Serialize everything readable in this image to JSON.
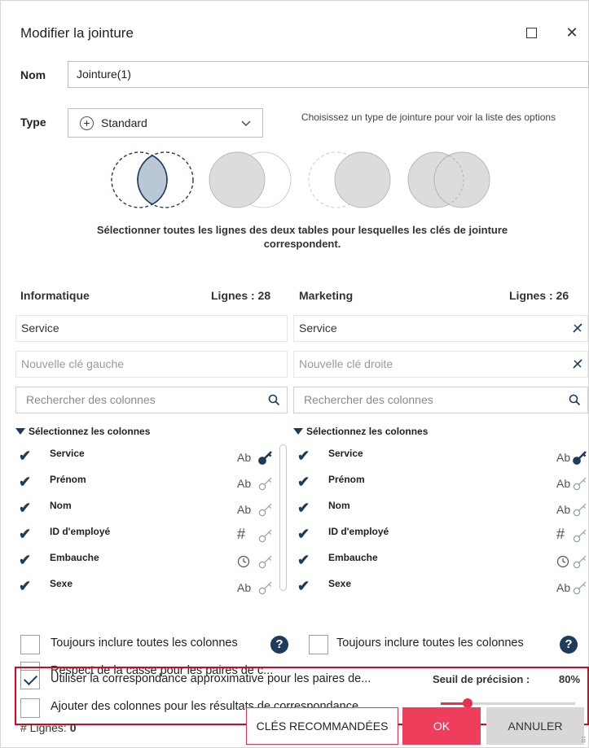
{
  "dialog": {
    "title": "Modifier la jointure",
    "maximize_icon": "maximize-icon",
    "close_label": "✕"
  },
  "name": {
    "label": "Nom",
    "value": "Jointure(1)"
  },
  "type": {
    "label": "Type",
    "selected": "Standard",
    "hint": "Choisissez un type de jointure pour voir la liste des options"
  },
  "join_types": [
    {
      "id": "inner",
      "icon": "inner-join-icon",
      "selected": true
    },
    {
      "id": "left",
      "icon": "left-join-icon",
      "selected": false
    },
    {
      "id": "right",
      "icon": "right-join-icon",
      "selected": false
    },
    {
      "id": "outer",
      "icon": "outer-join-icon",
      "selected": false
    }
  ],
  "join_description": "Sélectionner toutes les lignes des deux tables pour lesquelles les clés de jointure correspondent.",
  "left_table": {
    "name": "Informatique",
    "rows": "Lignes : 28",
    "key": "Service",
    "new_key_placeholder": "Nouvelle clé gauche",
    "search_placeholder": "Rechercher des colonnes",
    "select_header": "Sélectionnez les colonnes",
    "columns": [
      {
        "name": "Service",
        "type": "Ab",
        "is_key": true
      },
      {
        "name": "Prénom",
        "type": "Ab",
        "is_key": false
      },
      {
        "name": "Nom",
        "type": "Ab",
        "is_key": false
      },
      {
        "name": "ID d'employé",
        "type": "#",
        "is_key": false
      },
      {
        "name": "Embauche",
        "type": "date",
        "is_key": false
      },
      {
        "name": "Sexe",
        "type": "Ab",
        "is_key": false
      }
    ],
    "always_include": "Toujours inclure toutes les colonnes"
  },
  "right_table": {
    "name": "Marketing",
    "rows": "Lignes : 26",
    "key": "Service",
    "new_key_placeholder": "Nouvelle clé droite",
    "search_placeholder": "Rechercher des colonnes",
    "select_header": "Sélectionnez les colonnes",
    "columns": [
      {
        "name": "Service",
        "type": "Ab",
        "is_key": true
      },
      {
        "name": "Prénom",
        "type": "Ab",
        "is_key": false
      },
      {
        "name": "Nom",
        "type": "Ab",
        "is_key": false
      },
      {
        "name": "ID d'employé",
        "type": "#",
        "is_key": false
      },
      {
        "name": "Embauche",
        "type": "date",
        "is_key": false
      },
      {
        "name": "Sexe",
        "type": "Ab",
        "is_key": false
      }
    ],
    "always_include": "Toujours inclure toutes les colonnes"
  },
  "options": {
    "case_sensitive": "Respect de la casse pour les paires de c...",
    "fuzzy_match": "Utiliser la correspondance approximative pour les paires de...",
    "fuzzy_match_checked": true,
    "add_columns": "Ajouter des colonnes pour les résultats de correspondance...",
    "add_columns_checked": false
  },
  "threshold": {
    "label": "Seuil de précision :",
    "value": "80%",
    "level": 0.2
  },
  "footer": {
    "rows_label": "# Lignes:",
    "rows_value": "0",
    "recommend": "CLÉS RECOMMANDÉES",
    "ok": "OK",
    "cancel": "ANNULER"
  },
  "colors": {
    "accent": "#ef3d5c",
    "navy": "#1e3b5c",
    "highlight": "#e3001b"
  }
}
